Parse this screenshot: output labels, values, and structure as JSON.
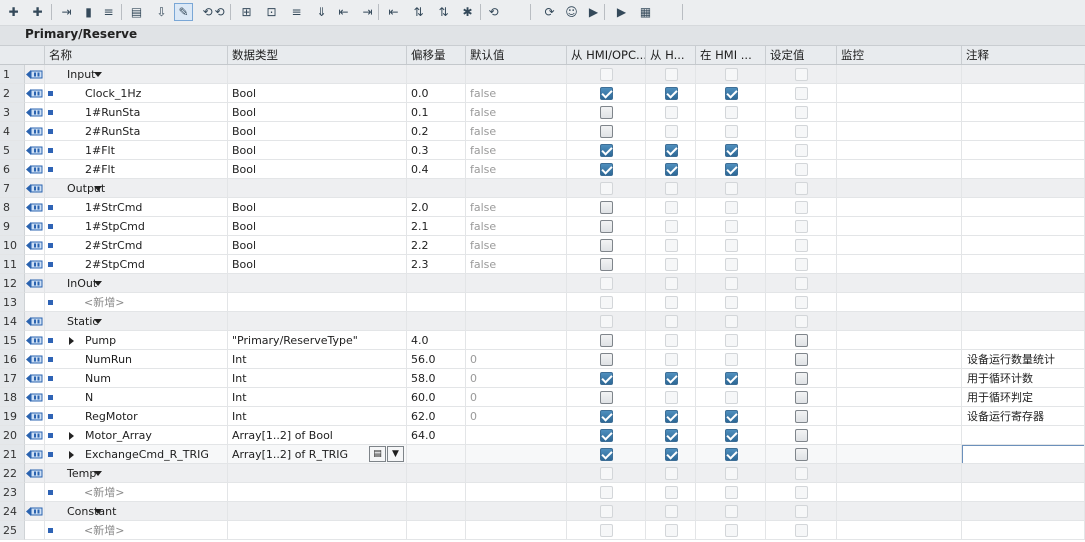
{
  "toolbar": {
    "buttons": [
      "insert-row-icon",
      "add-row-icon",
      "expand-icon",
      "monitor-icon",
      "list-icon",
      "tree-icon",
      "download-icon",
      "keep-values-icon",
      "snapshot-icon",
      "copy-snapshot-icon",
      "load-start-icon",
      "load-snapshot-icon",
      "hide-icon",
      "init-icon",
      "indent-left-icon",
      "indent-right-icon",
      "align-icon",
      "sort-icon",
      "sort2-icon",
      "break-icon",
      "nav-back-icon",
      "nav-fwd-icon",
      "user-icon",
      "compare-icon",
      "compare2-icon",
      "db-icon"
    ]
  },
  "title": "Primary/Reserve",
  "columns": {
    "name": "名称",
    "type": "数据类型",
    "offset": "偏移量",
    "default": "默认值",
    "hmi_opc": "从 HMI/OPC...",
    "hmi_h": "从 H...",
    "hmi_in": "在 HMI ...",
    "setpoint": "设定值",
    "monitor": "监控",
    "comment": "注释"
  },
  "rows": [
    {
      "n": "1",
      "kind": "group",
      "name": "Input",
      "type": "",
      "offset": "",
      "default": "",
      "cb": [
        "dis",
        "dis",
        "dis",
        "dis"
      ],
      "comment": ""
    },
    {
      "n": "2",
      "kind": "item",
      "name": "Clock_1Hz",
      "type": "Bool",
      "offset": "0.0",
      "default": "false",
      "cb": [
        "on",
        "on",
        "on",
        "dis"
      ],
      "comment": ""
    },
    {
      "n": "3",
      "kind": "item",
      "name": "1#RunSta",
      "type": "Bool",
      "offset": "0.1",
      "default": "false",
      "cb": [
        "off",
        "dis",
        "dis",
        "dis"
      ],
      "comment": ""
    },
    {
      "n": "4",
      "kind": "item",
      "name": "2#RunSta",
      "type": "Bool",
      "offset": "0.2",
      "default": "false",
      "cb": [
        "off",
        "dis",
        "dis",
        "dis"
      ],
      "comment": ""
    },
    {
      "n": "5",
      "kind": "item",
      "name": "1#Flt",
      "type": "Bool",
      "offset": "0.3",
      "default": "false",
      "cb": [
        "on",
        "on",
        "on",
        "dis"
      ],
      "comment": ""
    },
    {
      "n": "6",
      "kind": "item",
      "name": "2#Flt",
      "type": "Bool",
      "offset": "0.4",
      "default": "false",
      "cb": [
        "on",
        "on",
        "on",
        "dis"
      ],
      "comment": ""
    },
    {
      "n": "7",
      "kind": "group",
      "name": "Output",
      "type": "",
      "offset": "",
      "default": "",
      "cb": [
        "dis",
        "dis",
        "dis",
        "dis"
      ],
      "comment": ""
    },
    {
      "n": "8",
      "kind": "item",
      "name": "1#StrCmd",
      "type": "Bool",
      "offset": "2.0",
      "default": "false",
      "cb": [
        "off",
        "dis",
        "dis",
        "dis"
      ],
      "comment": ""
    },
    {
      "n": "9",
      "kind": "item",
      "name": "1#StpCmd",
      "type": "Bool",
      "offset": "2.1",
      "default": "false",
      "cb": [
        "off",
        "dis",
        "dis",
        "dis"
      ],
      "comment": ""
    },
    {
      "n": "10",
      "kind": "item",
      "name": "2#StrCmd",
      "type": "Bool",
      "offset": "2.2",
      "default": "false",
      "cb": [
        "off",
        "dis",
        "dis",
        "dis"
      ],
      "comment": ""
    },
    {
      "n": "11",
      "kind": "item",
      "name": "2#StpCmd",
      "type": "Bool",
      "offset": "2.3",
      "default": "false",
      "cb": [
        "off",
        "dis",
        "dis",
        "dis"
      ],
      "comment": ""
    },
    {
      "n": "12",
      "kind": "group",
      "name": "InOut",
      "type": "",
      "offset": "",
      "default": "",
      "cb": [
        "dis",
        "dis",
        "dis",
        "dis"
      ],
      "comment": ""
    },
    {
      "n": "13",
      "kind": "new",
      "name": "<新增>",
      "type": "",
      "offset": "",
      "default": "",
      "cb": [
        "dis",
        "dis",
        "dis",
        "dis"
      ],
      "comment": ""
    },
    {
      "n": "14",
      "kind": "group",
      "name": "Static",
      "type": "",
      "offset": "",
      "default": "",
      "cb": [
        "dis",
        "dis",
        "dis",
        "dis"
      ],
      "comment": ""
    },
    {
      "n": "15",
      "kind": "struct",
      "name": "Pump",
      "type": "\"Primary/ReserveType\"",
      "offset": "4.0",
      "default": "",
      "cb": [
        "off",
        "dis",
        "dis",
        "off"
      ],
      "comment": ""
    },
    {
      "n": "16",
      "kind": "item",
      "name": "NumRun",
      "type": "Int",
      "offset": "56.0",
      "default": "0",
      "cb": [
        "off",
        "dis",
        "dis",
        "off"
      ],
      "comment": "设备运行数量统计"
    },
    {
      "n": "17",
      "kind": "item",
      "name": "Num",
      "type": "Int",
      "offset": "58.0",
      "default": "0",
      "cb": [
        "on",
        "on",
        "on",
        "off"
      ],
      "comment": "用于循环计数"
    },
    {
      "n": "18",
      "kind": "item",
      "name": "N",
      "type": "Int",
      "offset": "60.0",
      "default": "0",
      "cb": [
        "off",
        "dis",
        "dis",
        "off"
      ],
      "comment": "用于循环判定"
    },
    {
      "n": "19",
      "kind": "item",
      "name": "RegMotor",
      "type": "Int",
      "offset": "62.0",
      "default": "0",
      "cb": [
        "on",
        "on",
        "on",
        "off"
      ],
      "comment": "设备运行寄存器"
    },
    {
      "n": "20",
      "kind": "struct",
      "name": "Motor_Array",
      "type": "Array[1..2] of Bool",
      "offset": "64.0",
      "default": "",
      "cb": [
        "on",
        "on",
        "on",
        "off"
      ],
      "comment": ""
    },
    {
      "n": "21",
      "kind": "struct",
      "name": "ExchangeCmd_R_TRIG",
      "type": "Array[1..2] of R_TRIG",
      "offset": "",
      "default": "",
      "cb": [
        "on",
        "on",
        "on",
        "off"
      ],
      "comment": "",
      "editing": true
    },
    {
      "n": "22",
      "kind": "group",
      "name": "Temp",
      "type": "",
      "offset": "",
      "default": "",
      "cb": [
        "dis",
        "dis",
        "dis",
        "dis"
      ],
      "comment": ""
    },
    {
      "n": "23",
      "kind": "new",
      "name": "<新增>",
      "type": "",
      "offset": "",
      "default": "",
      "cb": [
        "dis",
        "dis",
        "dis",
        "dis"
      ],
      "comment": ""
    },
    {
      "n": "24",
      "kind": "group",
      "name": "Constant",
      "type": "",
      "offset": "",
      "default": "",
      "cb": [
        "dis",
        "dis",
        "dis",
        "dis"
      ],
      "comment": ""
    },
    {
      "n": "25",
      "kind": "new",
      "name": "<新增>",
      "type": "",
      "offset": "",
      "default": "",
      "cb": [
        "dis",
        "dis",
        "dis",
        "dis"
      ],
      "comment": ""
    }
  ]
}
